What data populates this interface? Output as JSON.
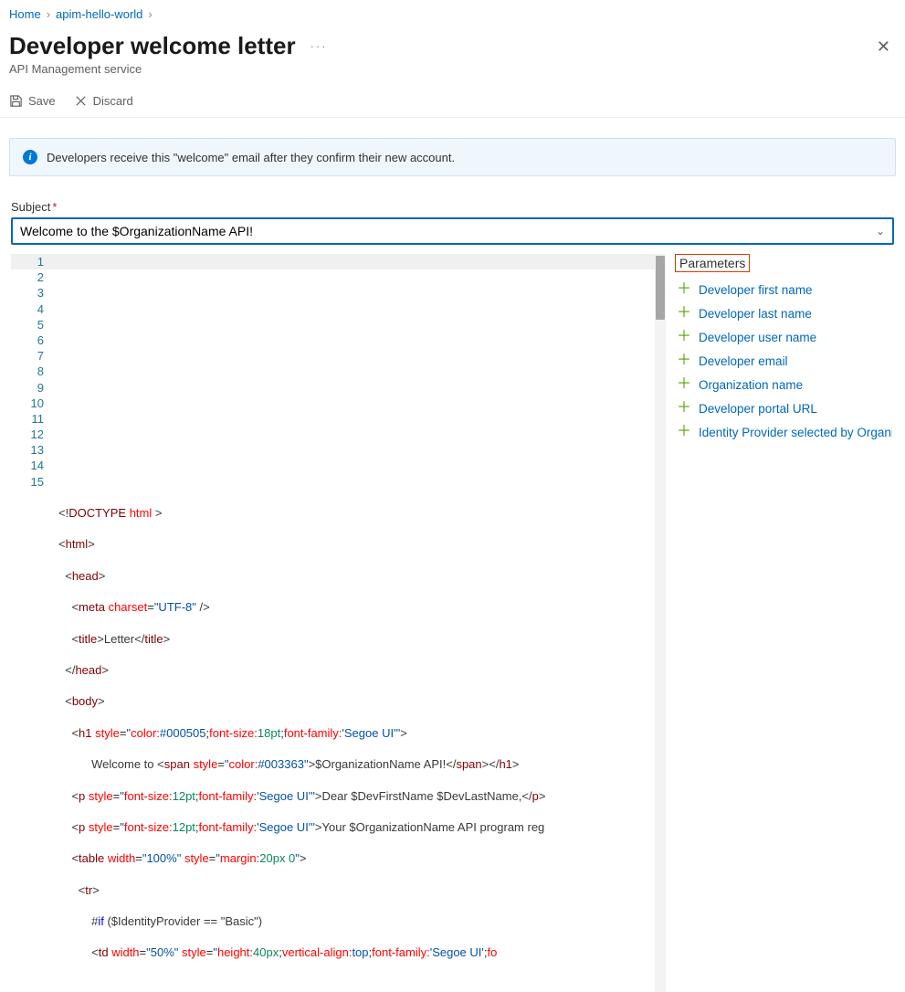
{
  "breadcrumb": {
    "home": "Home",
    "resource": "apim-hello-world"
  },
  "page": {
    "title": "Developer welcome letter",
    "subtitle": "API Management service"
  },
  "toolbar": {
    "save": "Save",
    "discard": "Discard"
  },
  "info": {
    "text": "Developers receive this \"welcome\" email after they confirm their new account."
  },
  "subject": {
    "label": "Subject",
    "value": "Welcome to the $OrganizationName API!"
  },
  "editor": {
    "lines": [
      "1",
      "2",
      "3",
      "4",
      "5",
      "6",
      "7",
      "8",
      "9",
      "10",
      "11",
      "12",
      "13",
      "14",
      "15"
    ]
  },
  "sidebar": {
    "heading": "Parameters",
    "items": [
      "Developer first name",
      "Developer last name",
      "Developer user name",
      "Developer email",
      "Organization name",
      "Developer portal URL",
      "Identity Provider selected by Organization"
    ]
  }
}
